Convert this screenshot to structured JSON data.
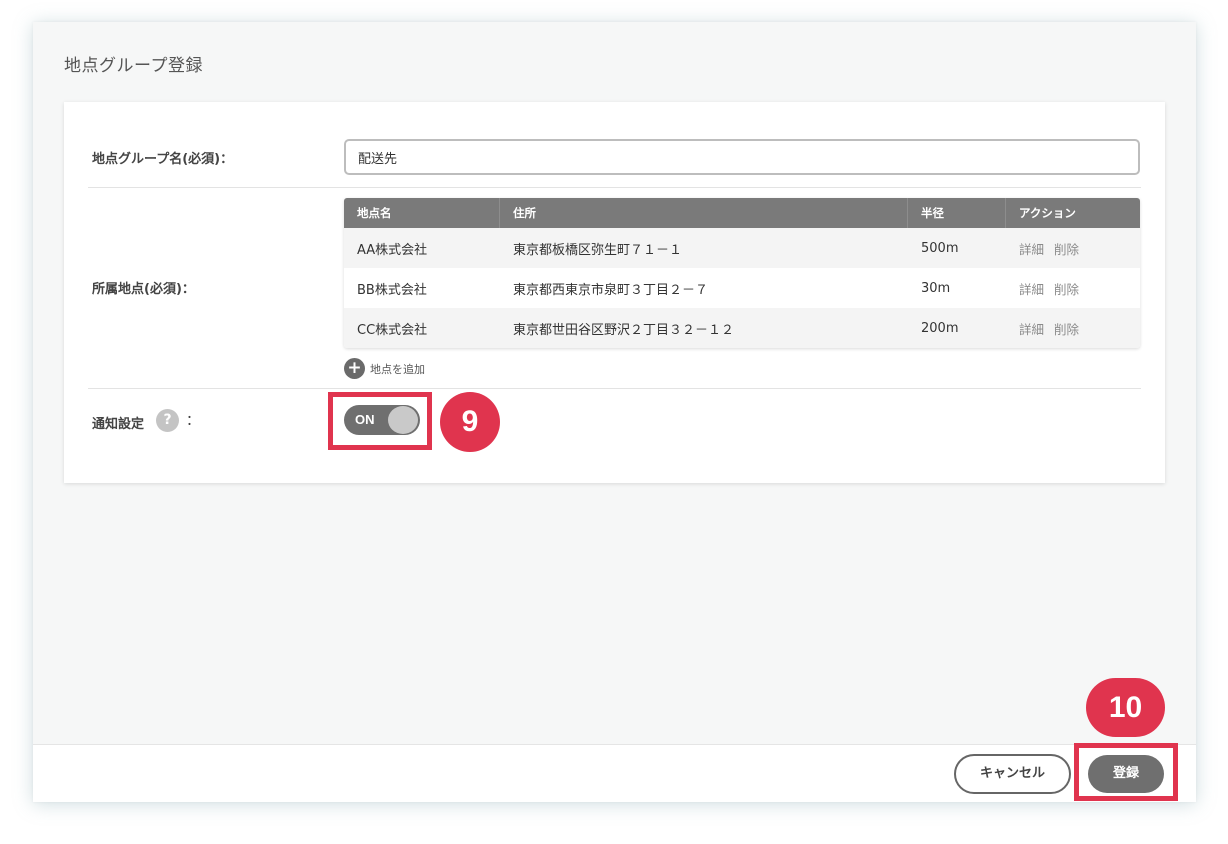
{
  "dialog": {
    "title": "地点グループ登録"
  },
  "form": {
    "group_name_label": "地点グループ名(必須)：",
    "group_name_value": "配送先",
    "points_label": "所属地点(必須)：",
    "notify_label": "通知設定",
    "notify_help": "?",
    "notify_colon": "：",
    "notify_toggle_text": "ON",
    "add_point_icon": "+",
    "add_point_label": "地点を追加"
  },
  "table": {
    "headers": [
      "地点名",
      "住所",
      "半径",
      "アクション"
    ],
    "rows": [
      {
        "name": "AA株式会社",
        "address": "東京都板橋区弥生町７１－１",
        "radius": "500m",
        "detail": "詳細",
        "delete": "削除"
      },
      {
        "name": "BB株式会社",
        "address": "東京都西東京市泉町３丁目２－７",
        "radius": "30m",
        "detail": "詳細",
        "delete": "削除"
      },
      {
        "name": "CC株式会社",
        "address": "東京都世田谷区野沢２丁目３２－１２",
        "radius": "200m",
        "detail": "詳細",
        "delete": "削除"
      }
    ]
  },
  "footer": {
    "cancel_label": "キャンセル",
    "register_label": "登録"
  },
  "annotations": {
    "badge_toggle": "9",
    "badge_register": "10"
  },
  "colors": {
    "highlight": "#e0344e",
    "table_header": "#7a7a7a",
    "toggle_bg": "#6f6f6f"
  },
  "icons": {
    "help": "question-circle-icon",
    "add": "plus-circle-icon"
  }
}
